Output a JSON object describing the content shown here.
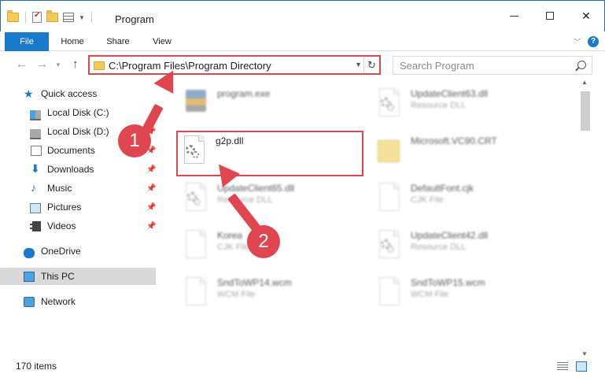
{
  "window": {
    "title": "Program",
    "controls": {
      "minimize": "",
      "maximize": "",
      "close": "✕"
    }
  },
  "ribbon": {
    "tabs": [
      {
        "label": "File",
        "active": true
      },
      {
        "label": "Home"
      },
      {
        "label": "Share"
      },
      {
        "label": "View"
      }
    ],
    "help": "?"
  },
  "address": {
    "path": "C:\\Program Files\\Program Directory",
    "refresh_icon": "↻",
    "search_placeholder": "Search Program"
  },
  "sidebar": {
    "items": [
      {
        "label": "Quick access",
        "icon": "star-icon"
      },
      {
        "label": "Local Disk (C:)",
        "icon": "drive-icon"
      },
      {
        "label": "Local Disk (D:)",
        "icon": "drive-icon",
        "pinned": true
      },
      {
        "label": "Documents",
        "icon": "documents-icon",
        "pinned": true
      },
      {
        "label": "Downloads",
        "icon": "download-icon",
        "pinned": true
      },
      {
        "label": "Music",
        "icon": "music-icon",
        "pinned": true
      },
      {
        "label": "Pictures",
        "icon": "pictures-icon",
        "pinned": true
      },
      {
        "label": "Videos",
        "icon": "videos-icon",
        "pinned": true
      },
      {
        "label": "OneDrive",
        "icon": "cloud-icon"
      },
      {
        "label": "This PC",
        "icon": "computer-icon",
        "selected": true
      },
      {
        "label": "Network",
        "icon": "network-icon"
      }
    ]
  },
  "files": [
    {
      "name": "program.exe",
      "type": ""
    },
    {
      "name": "UpdateClient63.dll",
      "type": "Resource DLL"
    },
    {
      "name": "g2p.dll",
      "type": ""
    },
    {
      "name": "Microsoft.VC90.CRT",
      "type": ""
    },
    {
      "name": "UpdateClient65.dll",
      "type": "Resource DLL"
    },
    {
      "name": "DefaultFont.cjk",
      "type": "CJK File"
    },
    {
      "name": "Korea",
      "type": "CJK File"
    },
    {
      "name": "UpdateClient42.dll",
      "type": "Resource DLL"
    },
    {
      "name": "SndToWP14.wcm",
      "type": "WCM File"
    },
    {
      "name": "SndToWP15.wcm",
      "type": "WCM File"
    }
  ],
  "status": {
    "item_count": "170 items"
  },
  "annotations": {
    "step1": "1",
    "step2": "2"
  },
  "colors": {
    "accent": "#1979ca",
    "highlight": "#e0464f"
  }
}
